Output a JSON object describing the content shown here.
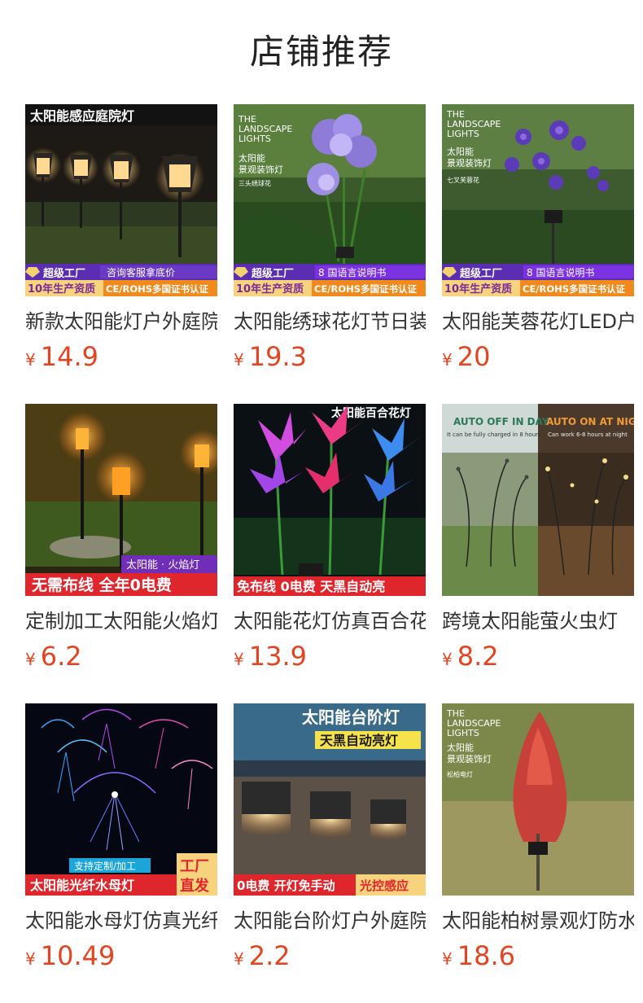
{
  "page": {
    "title": "店铺推荐"
  },
  "products": [
    {
      "name": "新款太阳能灯户外庭院",
      "currency": "¥",
      "price": "14.9",
      "overlay_top": "太阳能感应庭院灯",
      "badge1": "超级工厂",
      "badge2": "咨询客服拿底价",
      "badge3": "10年生产资质",
      "badge4": "CE/ROHS多国证书认证"
    },
    {
      "name": "太阳能绣球花灯节日装饰",
      "currency": "¥",
      "price": "19.3",
      "brand1": "THE",
      "brand2": "LANDSCAPE",
      "brand3": "LIGHTS",
      "label": "太阳能",
      "label2": "景观装饰灯",
      "label3": "三头绣球花",
      "badge1": "超级工厂",
      "badge2": "8 国语言说明书",
      "badge3": "10年生产资质",
      "badge4": "CE/ROHS多国证书认证"
    },
    {
      "name": "太阳能芙蓉花灯LED户外",
      "currency": "¥",
      "price": "20",
      "brand1": "THE",
      "brand2": "LANDSCAPE",
      "brand3": "LIGHTS",
      "label": "太阳能",
      "label2": "景观装饰灯",
      "label3": "七叉芙蓉花",
      "badge1": "超级工厂",
      "badge2": "8 国语言说明书",
      "badge3": "10年生产资质",
      "badge4": "CE/ROHS多国证书认证"
    },
    {
      "name": "定制加工太阳能火焰灯",
      "currency": "¥",
      "price": "6.2",
      "tag": "太阳能 · 火焰灯",
      "banner": "无需布线 全年0电费"
    },
    {
      "name": "太阳能花灯仿真百合花灯",
      "currency": "¥",
      "price": "13.9",
      "overlay_top": "太阳能百合花灯",
      "banner": "免布线 0电费 天黑自动亮"
    },
    {
      "name": "跨境太阳能萤火虫灯",
      "currency": "¥",
      "price": "8.2",
      "left_title": "AUTO OFF IN DAY",
      "left_sub": "It can be fully charged in 8 hours",
      "right_title": "AUTO ON AT NIGHT",
      "right_sub": "Can work 6-8 hours at night"
    },
    {
      "name": "太阳能水母灯仿真光纤",
      "currency": "¥",
      "price": "10.49",
      "tag": "支持定制/加工",
      "banner": "太阳能光纤水母灯",
      "side1": "工厂",
      "side2": "直发"
    },
    {
      "name": "太阳能台阶灯户外庭院",
      "currency": "¥",
      "price": "2.2",
      "overlay_top": "太阳能台阶灯",
      "overlay_sub": "天黑自动亮灯",
      "banner": "0电费 开灯免手动",
      "banner2": "光控感应"
    },
    {
      "name": "太阳能柏树景观灯防水",
      "currency": "¥",
      "price": "18.6",
      "brand1": "THE",
      "brand2": "LANDSCAPE",
      "brand3": "LIGHTS",
      "label": "太阳能",
      "label2": "景观装饰灯",
      "label3": "松柏电灯"
    }
  ],
  "colors": {
    "price": "#e4441f",
    "badge_purple": "#5a2db3",
    "badge_orange": "#f08a1d",
    "banner_red": "#e0262d"
  }
}
